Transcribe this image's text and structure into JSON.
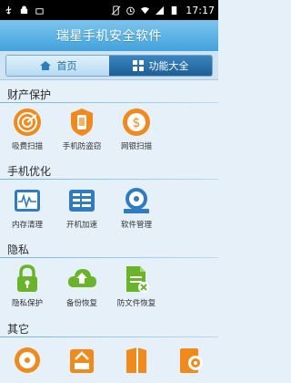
{
  "status_bar": {
    "time": "17:17"
  },
  "header": {
    "title": "瑞星手机安全软件"
  },
  "tabs": [
    {
      "label": "首页",
      "active": false
    },
    {
      "label": "功能大全",
      "active": true
    }
  ],
  "sections": [
    {
      "title": "财产保护",
      "items": [
        {
          "label": "吸费扫描",
          "icon": "radar-icon"
        },
        {
          "label": "手机防盗窃",
          "icon": "phone-shield-icon"
        },
        {
          "label": "网银扫描",
          "icon": "bank-scan-icon"
        }
      ]
    },
    {
      "title": "手机优化",
      "items": [
        {
          "label": "内存清理",
          "icon": "memory-monitor-icon"
        },
        {
          "label": "开机加速",
          "icon": "boot-speed-icon"
        },
        {
          "label": "软件管理",
          "icon": "software-disc-icon"
        }
      ]
    },
    {
      "title": "隐私",
      "items": [
        {
          "label": "隐私保护",
          "icon": "lock-icon"
        },
        {
          "label": "备份恢复",
          "icon": "cloud-backup-icon"
        },
        {
          "label": "防文件恢复",
          "icon": "file-shred-icon"
        }
      ]
    },
    {
      "title": "其它",
      "items": []
    }
  ],
  "colors": {
    "accent": "#43a3dc",
    "orange": "#f08a1c",
    "green": "#6ab42a",
    "blue": "#2f7cc2"
  }
}
